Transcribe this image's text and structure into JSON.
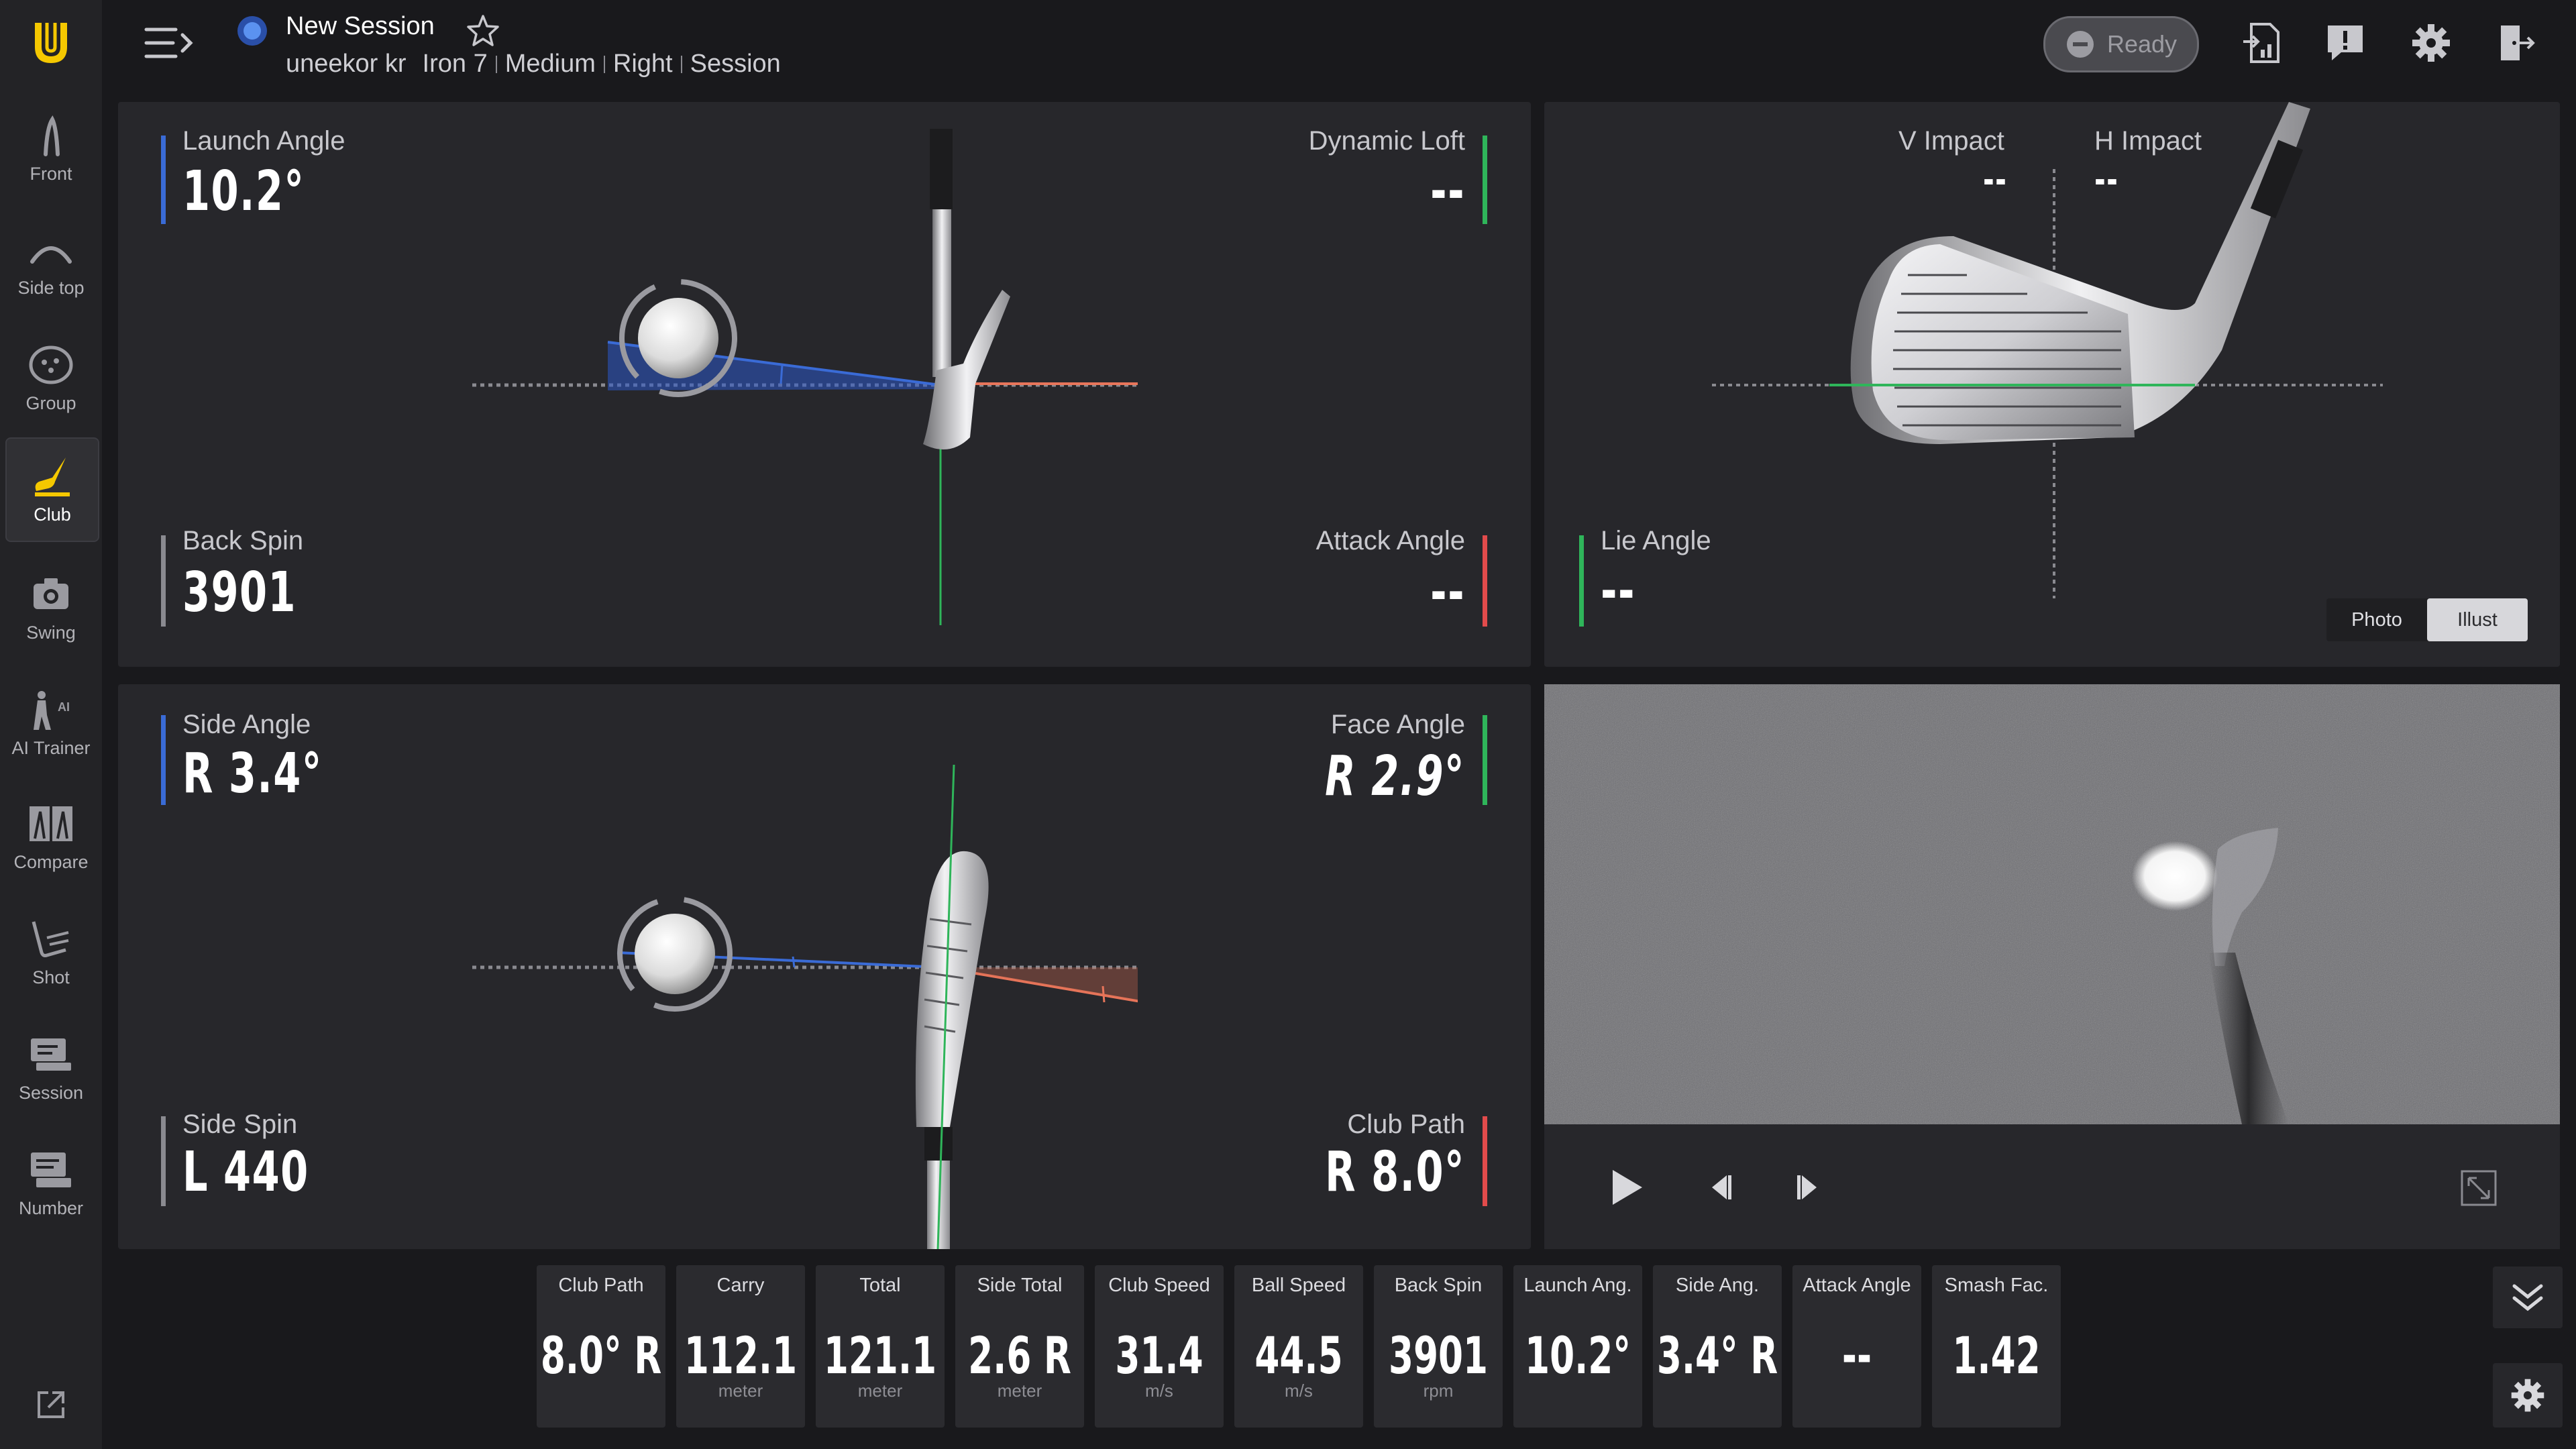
{
  "header": {
    "session_title": "New Session",
    "sub": {
      "user": "uneekor kr",
      "club": "Iron 7",
      "level": "Medium",
      "hand": "Right",
      "mode": "Session"
    },
    "status": "Ready"
  },
  "sidebar": {
    "items": [
      {
        "label": "Front",
        "icon": "front-view-icon"
      },
      {
        "label": "Side top",
        "icon": "side-top-icon"
      },
      {
        "label": "Group",
        "icon": "group-icon"
      },
      {
        "label": "Club",
        "icon": "club-icon",
        "active": true
      },
      {
        "label": "Swing",
        "icon": "camera-icon"
      },
      {
        "label": "AI Trainer",
        "icon": "ai-trainer-icon"
      },
      {
        "label": "Compare",
        "icon": "compare-icon"
      },
      {
        "label": "Shot",
        "icon": "shot-icon"
      },
      {
        "label": "Session",
        "icon": "session-icon"
      },
      {
        "label": "Number",
        "icon": "number-icon"
      }
    ]
  },
  "panel_side": {
    "launch_angle": {
      "label": "Launch Angle",
      "value": "10.2°"
    },
    "dynamic_loft": {
      "label": "Dynamic Loft",
      "value": "--"
    },
    "back_spin": {
      "label": "Back Spin",
      "value": "3901"
    },
    "attack_angle": {
      "label": "Attack Angle",
      "value": "--"
    }
  },
  "panel_impact": {
    "v_impact": {
      "label": "V Impact",
      "value": "--"
    },
    "h_impact": {
      "label": "H Impact",
      "value": "--"
    },
    "lie_angle": {
      "label": "Lie Angle",
      "value": "--"
    },
    "toggle": {
      "photo": "Photo",
      "illust": "Illust",
      "selected": "Illust"
    }
  },
  "panel_top": {
    "side_angle": {
      "label": "Side Angle",
      "value": "R 3.4°"
    },
    "face_angle": {
      "label": "Face Angle",
      "value": "R 2.9°"
    },
    "side_spin": {
      "label": "Side Spin",
      "value": "L 440"
    },
    "club_path": {
      "label": "Club Path",
      "value": "R 8.0°"
    }
  },
  "stats": [
    {
      "label": "Club Path",
      "value": "8.0° R",
      "unit": ""
    },
    {
      "label": "Carry",
      "value": "112.1",
      "unit": "meter"
    },
    {
      "label": "Total",
      "value": "121.1",
      "unit": "meter"
    },
    {
      "label": "Side Total",
      "value": "2.6 R",
      "unit": "meter"
    },
    {
      "label": "Club Speed",
      "value": "31.4",
      "unit": "m/s"
    },
    {
      "label": "Ball Speed",
      "value": "44.5",
      "unit": "m/s"
    },
    {
      "label": "Back Spin",
      "value": "3901",
      "unit": "rpm"
    },
    {
      "label": "Launch Ang.",
      "value": "10.2°",
      "unit": ""
    },
    {
      "label": "Side Ang.",
      "value": "3.4° R",
      "unit": ""
    },
    {
      "label": "Attack Angle",
      "value": "--",
      "unit": ""
    },
    {
      "label": "Smash Fac.",
      "value": "1.42",
      "unit": ""
    }
  ],
  "colors": {
    "accent": "#f5c800",
    "blue": "#3a6bd6",
    "green": "#2fb55a",
    "red": "#e24b4b"
  }
}
